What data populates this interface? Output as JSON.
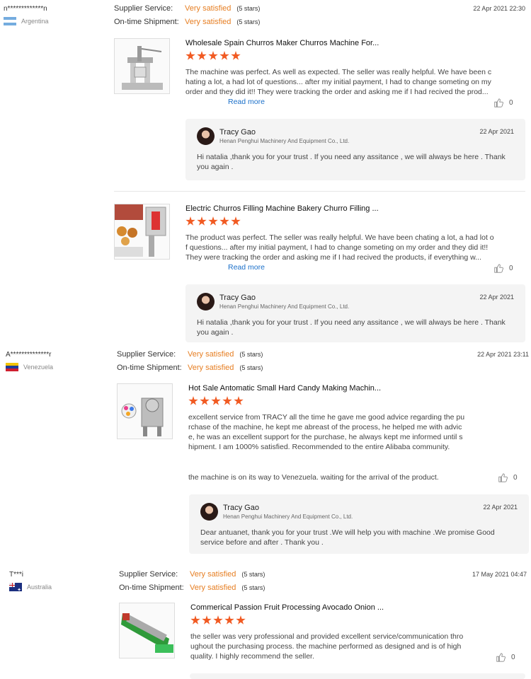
{
  "common": {
    "supplier_label": "Supplier Service:",
    "shipment_label": "On-time Shipment:",
    "rating_value": "Very satisfied",
    "stars_label": "(5 stars)",
    "read_more": "Read more"
  },
  "reviews": [
    {
      "user": "n*************n",
      "country": "Argentina",
      "date": "22 Apr 2021 22:30",
      "products": [
        {
          "title": "Wholesale Spain Churros Maker Churros Machine For...",
          "text": "The machine was perfect. As well as expected. The seller was really helpful. We have been chating a lot, a had lot of questions... after my initial payment, I had to change someting on my order and they did it!! They were tracking the order and asking me if I had recived the prod...",
          "likes": "0",
          "reply": {
            "name": "Tracy Gao",
            "company": "Henan Penghui Machinery And Equipment Co., Ltd.",
            "date": "22 Apr 2021",
            "text": "Hi natalia ,thank you for your trust . If you need any assitance , we will  always be here . Thank you again ."
          }
        },
        {
          "title": "Electric Churros Filling Machine Bakery Churro Filling ...",
          "text": "The product was perfect. The seller was really helpful. We have been chating a lot, a had lot of questions... after my initial payment, I had to change someting on my order and they did it!! They were tracking the order and asking me if I had recived the products, if everything w...",
          "likes": "0",
          "reply": {
            "name": "Tracy Gao",
            "company": "Henan Penghui Machinery And Equipment Co., Ltd.",
            "date": "22 Apr 2021",
            "text": "Hi natalia ,thank you for your trust . If you need any assitance , we will  always be here . Thank you again ."
          }
        }
      ]
    },
    {
      "user": "A**************r",
      "country": "Venezuela",
      "date": "22 Apr 2021 23:11",
      "products": [
        {
          "title": "Hot Sale Antomatic Small Hard Candy Making Machin...",
          "text": "excellent service from TRACY all the time he gave me good advice regarding the purchase of the machine, he kept me abreast of the process, he helped me with advice, he was an excellent support for the purchase, he always kept me informed until shipment. I am 1000% satisfied. Recommended to the entire Alibaba community.",
          "text2": "the machine is on its way to Venezuela. waiting for the arrival of the product.",
          "likes": "0",
          "reply": {
            "name": "Tracy Gao",
            "company": "Henan Penghui Machinery And Equipment Co., Ltd.",
            "date": "22 Apr 2021",
            "text": "Dear antuanet, thank you for your trust .We will  help you with machine .We promise Good service  before and after . Thank you ."
          }
        }
      ]
    },
    {
      "user": "T***i",
      "country": "Australia",
      "date": "17 May 2021 04:47",
      "products": [
        {
          "title": "Commerical Passion Fruit Processing Avocado Onion ...",
          "text": "the seller was very professional and provided excellent service/communication throughout the purchasing process. the machine performed as designed and is of high quality. I highly recommend the seller.",
          "likes": "0"
        }
      ]
    }
  ],
  "colors": {
    "accent": "#e67e22",
    "star": "#f15a22",
    "link": "#1a6fc9"
  }
}
